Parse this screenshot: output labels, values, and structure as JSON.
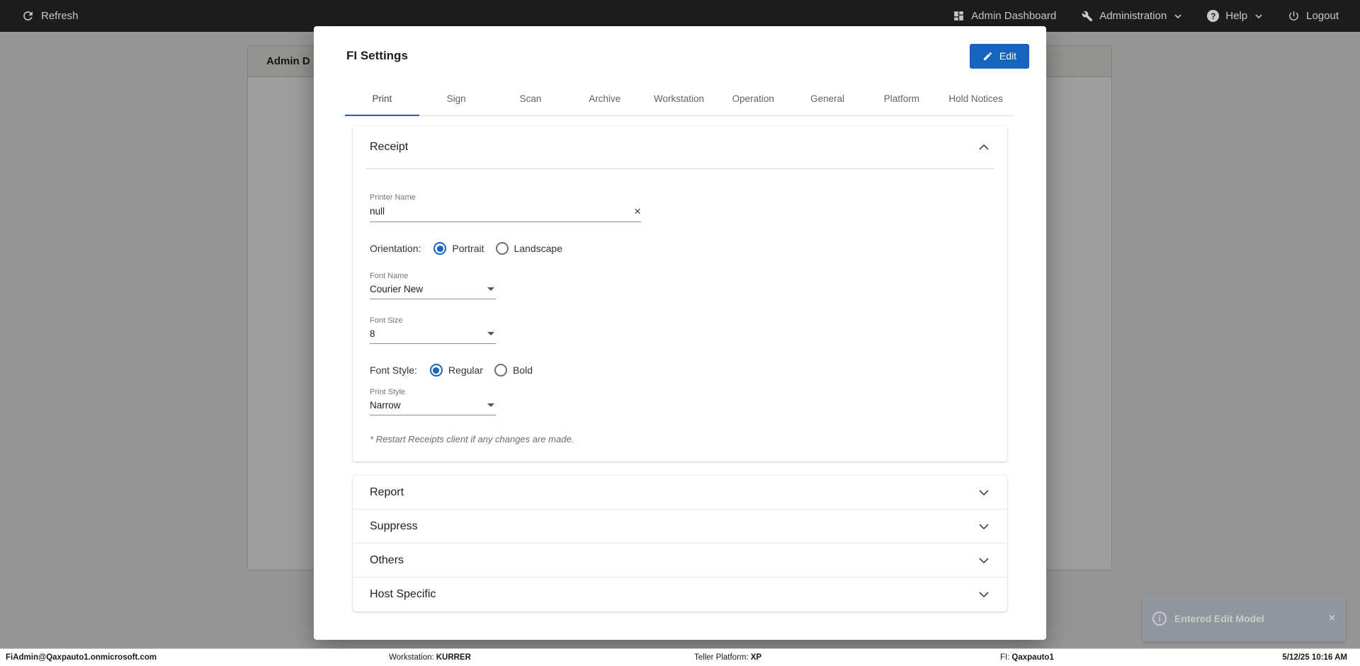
{
  "topbar": {
    "refresh": "Refresh",
    "admin_dashboard": "Admin Dashboard",
    "administration": "Administration",
    "help": "Help",
    "help_icon_glyph": "?",
    "logout": "Logout"
  },
  "background_page": {
    "card_title": "Admin D"
  },
  "dialog": {
    "title": "FI Settings",
    "edit_button": "Edit",
    "active_tab": "Print",
    "tabs": [
      {
        "label": "Print"
      },
      {
        "label": "Sign"
      },
      {
        "label": "Scan"
      },
      {
        "label": "Archive"
      },
      {
        "label": "Workstation"
      },
      {
        "label": "Operation"
      },
      {
        "label": "General"
      },
      {
        "label": "Platform"
      },
      {
        "label": "Hold Notices"
      }
    ],
    "receipt": {
      "title": "Receipt",
      "printer_name_label": "Printer Name",
      "printer_name_value": "null",
      "clear_glyph": "×",
      "orientation_label": "Orientation:",
      "orientation_portrait": "Portrait",
      "orientation_landscape": "Landscape",
      "orientation_selected": "Portrait",
      "font_name_label": "Font Name",
      "font_name_value": "Courier New",
      "font_size_label": "Font Size",
      "font_size_value": "8",
      "font_style_label": "Font Style:",
      "font_style_regular": "Regular",
      "font_style_bold": "Bold",
      "font_style_selected": "Regular",
      "print_style_label": "Print Style",
      "print_style_value": "Narrow",
      "note": "* Restart Receipts client if any changes are made."
    },
    "sections": [
      {
        "title": "Report"
      },
      {
        "title": "Suppress"
      },
      {
        "title": "Others"
      },
      {
        "title": "Host Specific"
      }
    ]
  },
  "statusbar": {
    "user": "FiAdmin@Qaxpauto1.onmicrosoft.com",
    "workstation_label": "Workstation:",
    "workstation_value": "KURRER",
    "teller_platform_label": "Teller Platform:",
    "teller_platform_value": "XP",
    "fi_label": "FI:",
    "fi_value": "Qaxpauto1",
    "datetime": "5/12/25 10:16 AM"
  },
  "toast": {
    "message": "Entered Edit Model",
    "info_glyph": "i",
    "close_glyph": "×"
  },
  "colors": {
    "accent": "#1565c0",
    "topbar_bg": "#1d1d1d"
  }
}
